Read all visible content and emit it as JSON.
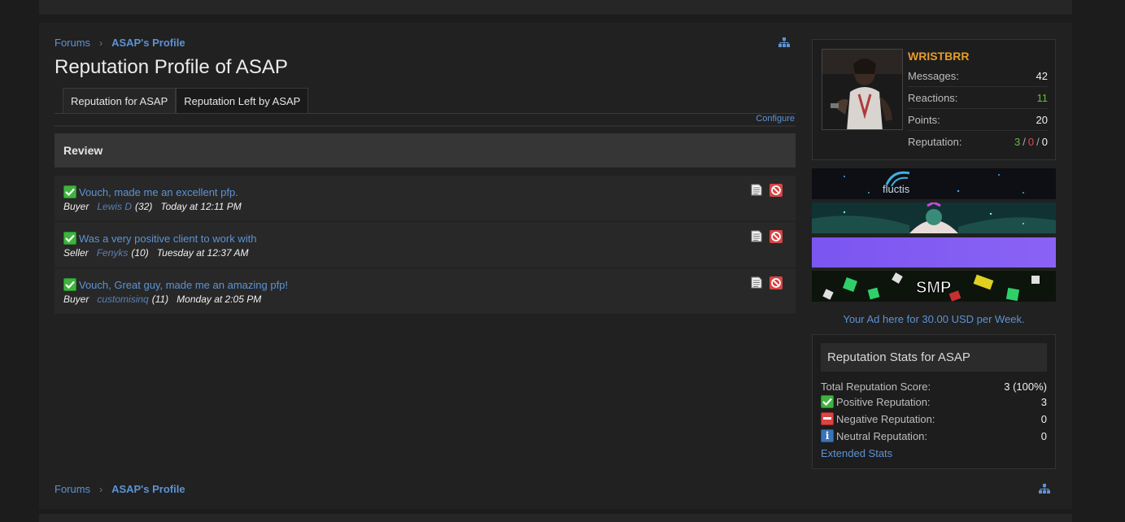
{
  "breadcrumb": {
    "forums": "Forums",
    "profile": "ASAP's Profile"
  },
  "page": {
    "title": "Reputation Profile of ASAP"
  },
  "tabs": [
    {
      "label": "Reputation for ASAP",
      "active": true
    },
    {
      "label": "Reputation Left by ASAP",
      "active": false
    }
  ],
  "configure_label": "Configure",
  "review_header": "Review",
  "reputations": [
    {
      "message": "Vouch, made me an excellent pfp.",
      "role": "Buyer",
      "user": "Lewis D",
      "count": "(32)",
      "time": "Today at 12:11 PM"
    },
    {
      "message": "Was a very positive client to work with",
      "role": "Seller",
      "user": "Fenyks",
      "count": "(10)",
      "time": "Tuesday at 12:37 AM"
    },
    {
      "message": "Vouch, Great guy, made me an amazing pfp!",
      "role": "Buyer",
      "user": "customisinq",
      "count": "(11)",
      "time": "Monday at 2:05 PM"
    }
  ],
  "user_card": {
    "username": "WRISTBRR",
    "messages_label": "Messages:",
    "messages": "42",
    "reactions_label": "Reactions:",
    "reactions": "11",
    "points_label": "Points:",
    "points": "20",
    "reputation_label": "Reputation:",
    "rep_pos": "3",
    "rep_sep": "/",
    "rep_neg": "0",
    "rep_neu": "0"
  },
  "ads": {
    "banner2_text": "SMP",
    "banner1_text": "fluctis",
    "ad_text": "Your Ad here for 30.00 USD per Week."
  },
  "stats": {
    "title": "Reputation Stats for ASAP",
    "total_label": "Total Reputation Score:",
    "total": "3 (100%)",
    "positive_label": "Positive Reputation:",
    "positive": "3",
    "negative_label": "Negative Reputation:",
    "negative": "0",
    "neutral_label": "Neutral Reputation:",
    "neutral": "0",
    "extended_label": "Extended Stats"
  },
  "colors": {
    "link": "#5c93d4",
    "username": "#e59b2c",
    "positive": "#6aba3a",
    "negative": "#e24a4a"
  }
}
